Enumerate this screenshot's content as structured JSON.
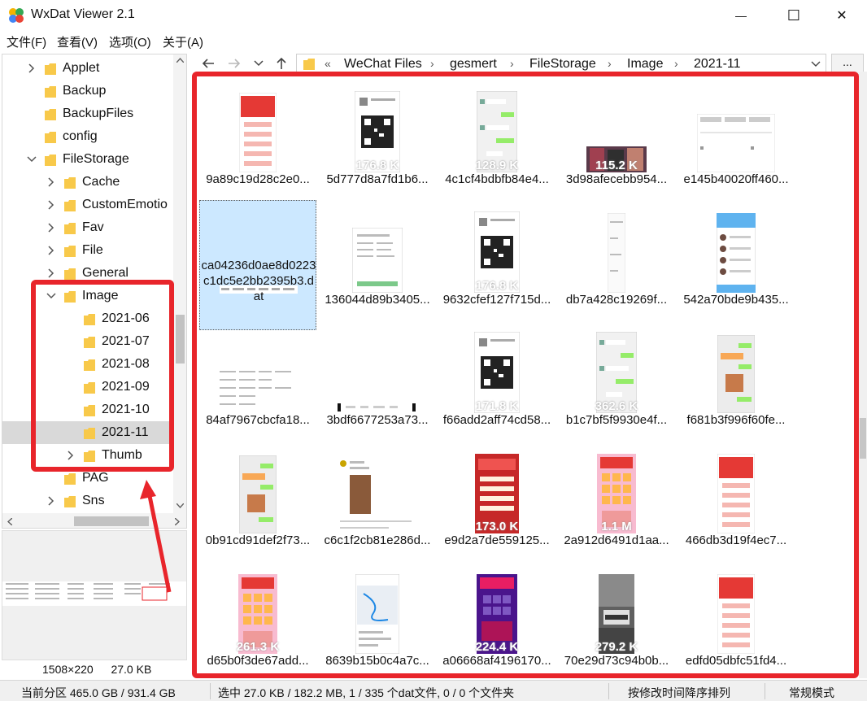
{
  "window": {
    "title": "WxDat Viewer 2.1",
    "minimize_glyph": "—",
    "maximize_glyph": "☐",
    "close_glyph": "✕"
  },
  "menu": [
    "文件(F)",
    "查看(V)",
    "选项(O)",
    "关于(A)"
  ],
  "tree": {
    "items": [
      {
        "label": "Applet",
        "level": 1,
        "expand": "collapsed"
      },
      {
        "label": "Backup",
        "level": 1,
        "expand": "none"
      },
      {
        "label": "BackupFiles",
        "level": 1,
        "expand": "none"
      },
      {
        "label": "config",
        "level": 1,
        "expand": "none"
      },
      {
        "label": "FileStorage",
        "level": 1,
        "expand": "expanded"
      },
      {
        "label": "Cache",
        "level": 2,
        "expand": "collapsed"
      },
      {
        "label": "CustomEmotio",
        "level": 2,
        "expand": "collapsed"
      },
      {
        "label": "Fav",
        "level": 2,
        "expand": "collapsed"
      },
      {
        "label": "File",
        "level": 2,
        "expand": "collapsed"
      },
      {
        "label": "General",
        "level": 2,
        "expand": "collapsed"
      },
      {
        "label": "Image",
        "level": 2,
        "expand": "expanded"
      },
      {
        "label": "2021-06",
        "level": 3,
        "expand": "none"
      },
      {
        "label": "2021-07",
        "level": 3,
        "expand": "none"
      },
      {
        "label": "2021-08",
        "level": 3,
        "expand": "none"
      },
      {
        "label": "2021-09",
        "level": 3,
        "expand": "none"
      },
      {
        "label": "2021-10",
        "level": 3,
        "expand": "none"
      },
      {
        "label": "2021-11",
        "level": 3,
        "expand": "none",
        "selected": true
      },
      {
        "label": "Thumb",
        "level": 3,
        "expand": "collapsed"
      },
      {
        "label": "PAG",
        "level": 2,
        "expand": "none"
      },
      {
        "label": "Sns",
        "level": 2,
        "expand": "collapsed"
      }
    ]
  },
  "preview": {
    "dimensions": "1508×220",
    "size": "27.0 KB"
  },
  "address": {
    "prefix": "«",
    "crumbs": [
      "WeChat Files",
      "gesmert",
      "FileStorage",
      "Image",
      "2021-11"
    ],
    "more_label": "..."
  },
  "files": [
    {
      "name": "9a89c19d28c2e0...",
      "tag": "",
      "kind": "phone-red"
    },
    {
      "name": "5d777d8a7fd1b6...",
      "tag": "176.8 K",
      "kind": "qr"
    },
    {
      "name": "4c1cf4bdbfb84e4...",
      "tag": "128.9 K",
      "kind": "chat"
    },
    {
      "name": "3d98afecebb954...",
      "tag": "115.2 K",
      "kind": "photo-wide"
    },
    {
      "name": "e145b40020ff460...",
      "tag": "",
      "kind": "web"
    },
    {
      "name": "ca04236d0ae8d0223c1dc5e2bb2395b3.dat",
      "tag": "",
      "kind": "strip",
      "selected": true
    },
    {
      "name": "136044d89b3405...",
      "tag": "",
      "kind": "doc"
    },
    {
      "name": "9632cfef127f715d...",
      "tag": "176.8 K",
      "kind": "qr"
    },
    {
      "name": "db7a428c19269f...",
      "tag": "",
      "kind": "narrow"
    },
    {
      "name": "542a70bde9b435...",
      "tag": "",
      "kind": "phone-list"
    },
    {
      "name": "84af7967cbcfa18...",
      "tag": "",
      "kind": "table"
    },
    {
      "name": "3bdf6677253a73...",
      "tag": "",
      "kind": "bar"
    },
    {
      "name": "f66add2aff74cd58...",
      "tag": "171.8 K",
      "kind": "qr"
    },
    {
      "name": "b1c7bf5f9930e4f...",
      "tag": "362.6 K",
      "kind": "chat"
    },
    {
      "name": "f681b3f996f60fe...",
      "tag": "",
      "kind": "chat-color"
    },
    {
      "name": "0b91cd91def2f73...",
      "tag": "",
      "kind": "chat-color"
    },
    {
      "name": "c6c1f2cb81e286d...",
      "tag": "",
      "kind": "post"
    },
    {
      "name": "e9d2a7de559125...",
      "tag": "173.0 K",
      "kind": "promo-red"
    },
    {
      "name": "2a912d6491d1aa...",
      "tag": "1.1 M",
      "kind": "promo-game"
    },
    {
      "name": "466db3d19f4ec7...",
      "tag": "",
      "kind": "phone-red"
    },
    {
      "name": "d65b0f3de67add...",
      "tag": "261.3 K",
      "kind": "promo-game"
    },
    {
      "name": "8639b15b0c4a7c...",
      "tag": "",
      "kind": "map"
    },
    {
      "name": "a06668af4196170...",
      "tag": "224.4 K",
      "kind": "promo-purple"
    },
    {
      "name": "70e29d73c94b0b...",
      "tag": "279.2 K",
      "kind": "car"
    },
    {
      "name": "edfd05dbfc51fd4...",
      "tag": "",
      "kind": "phone-red"
    }
  ],
  "status": {
    "partition": "当前分区 465.0 GB / 931.4 GB",
    "selection": "选中 27.0 KB / 182.2 MB,  1 / 335 个dat文件,  0 / 0 个文件夹",
    "sort": "按修改时间降序排列",
    "mode": "常规模式"
  },
  "colors": {
    "highlight_red": "#e8252b",
    "folder_yellow": "#f8c94a",
    "selected_blue": "#cce8ff"
  }
}
